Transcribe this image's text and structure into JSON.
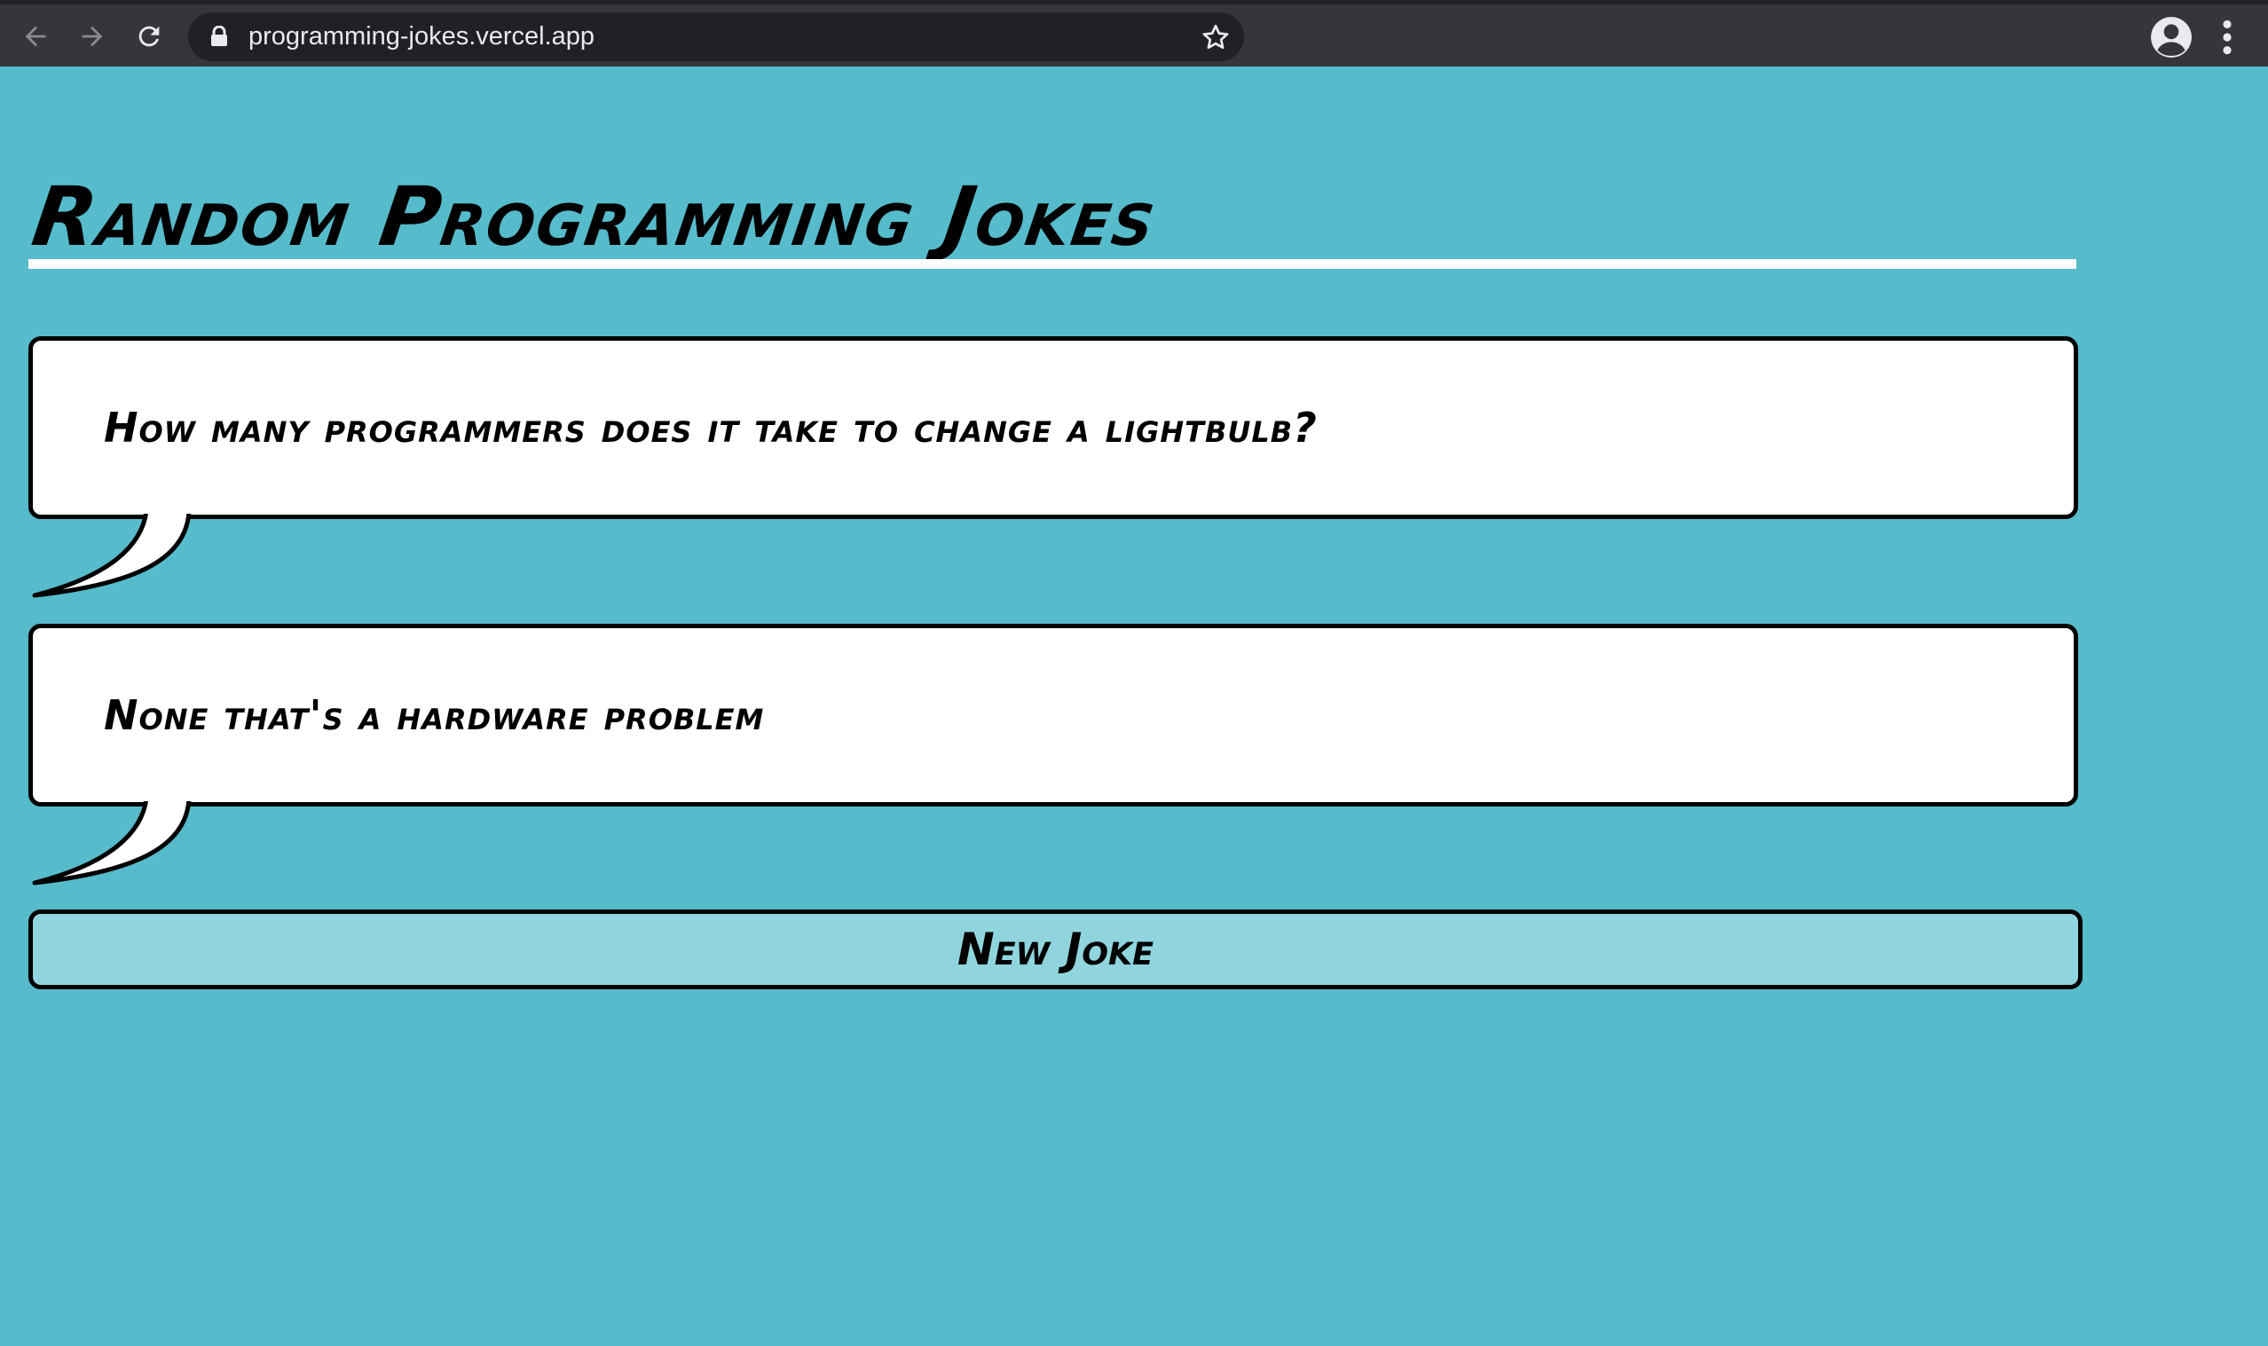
{
  "browser": {
    "url": "programming-jokes.vercel.app",
    "icons": [
      "back-arrow-icon",
      "forward-arrow-icon",
      "reload-icon",
      "lock-icon",
      "star-icon",
      "profile-icon",
      "menu-icon"
    ]
  },
  "page": {
    "title": "Random Programming Jokes",
    "setup": "How many programmers does it take to change a lightbulb?",
    "punchline": "None that's a hardware problem",
    "new_joke_label": "New Joke"
  },
  "colors": {
    "background": "#56bbcb",
    "button": "#90d5de",
    "bubble": "#ffffff",
    "chrome": "#35363a"
  }
}
